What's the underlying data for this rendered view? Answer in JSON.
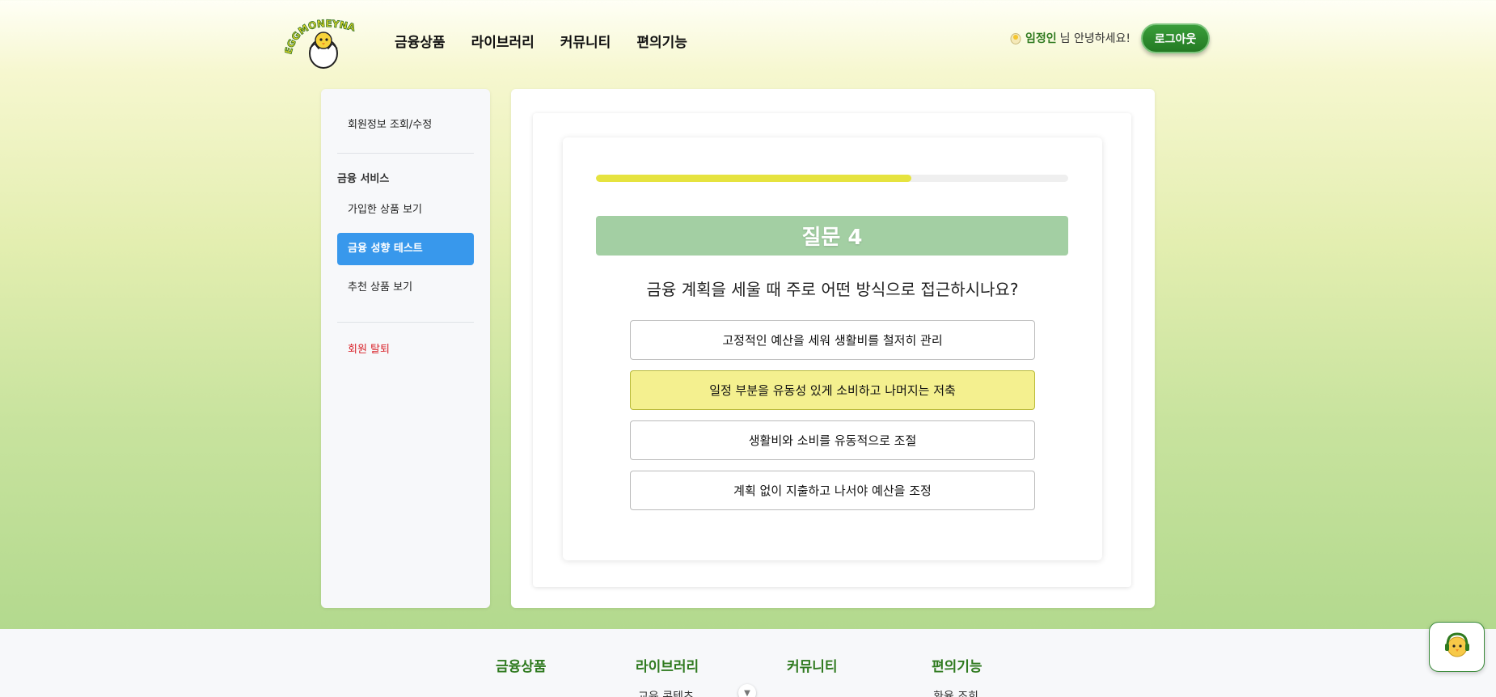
{
  "header": {
    "logo_text": "EGGMONEYNA",
    "nav": [
      "금융상품",
      "라이브러리",
      "커뮤니티",
      "편의기능"
    ],
    "user_name": "임정인",
    "greeting_suffix": "님 안녕하세요!",
    "logout_label": "로그아웃"
  },
  "sidebar": {
    "profile_link": "회원정보 조회/수정",
    "section_heading": "금융 서비스",
    "items": [
      {
        "label": "가입한 상품 보기",
        "active": false
      },
      {
        "label": "금융 성향 테스트",
        "active": true
      },
      {
        "label": "추천 상품 보기",
        "active": false
      }
    ],
    "withdraw_label": "회원 탈퇴"
  },
  "quiz": {
    "progress": 0.667,
    "question_title": "질문 4",
    "question_text": "금융 계획을 세울 때 주로 어떤 방식으로 접근하시나요?",
    "options": [
      "고정적인 예산을 세워 생활비를 철저히 관리",
      "일정 부분을 유동성 있게 소비하고 나머지는 저축",
      "생활비와 소비를 유동적으로 조절",
      "계획 없이 지출하고 나서야 예산을 조정"
    ],
    "selected_index": 1
  },
  "footer": {
    "columns": [
      {
        "title": "금융상품",
        "link": ""
      },
      {
        "title": "라이브러리",
        "link": "교육 콘텐츠"
      },
      {
        "title": "커뮤니티",
        "link": ""
      },
      {
        "title": "편의기능",
        "link": "환율 조회"
      }
    ]
  },
  "colors": {
    "accent_green": "#2f7a1f",
    "active_blue": "#3898ec",
    "progress_yellow": "#e6e33f",
    "selected_option": "#f4f08f",
    "danger_red": "#d9232a"
  },
  "icons": {
    "logo": "egg-chick-logo-icon",
    "greeting": "egg-icon",
    "scroll": "chevron-down-icon",
    "chatbot": "chick-headset-icon"
  }
}
